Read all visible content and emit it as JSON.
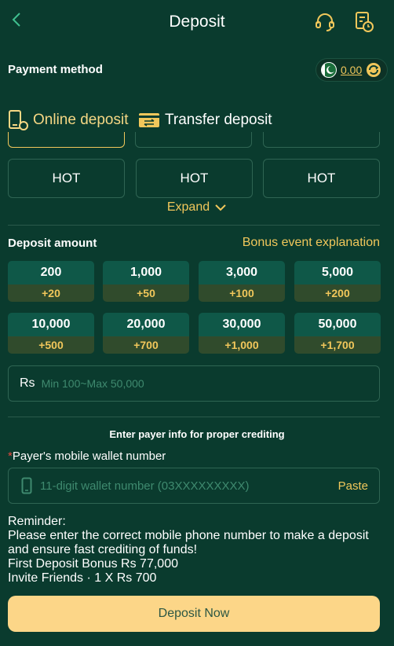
{
  "header": {
    "title": "Deposit"
  },
  "payment": {
    "label": "Payment method",
    "balance": "0.00"
  },
  "tabs": [
    {
      "label": "Online deposit",
      "active": true
    },
    {
      "label": "Transfer deposit",
      "active": false
    }
  ],
  "methods": [
    "HOT",
    "HOT",
    "HOT"
  ],
  "expand_label": "Expand",
  "deposit_amount": {
    "label": "Deposit amount",
    "bonus_link": "Bonus event explanation",
    "options": [
      {
        "amount": "200",
        "bonus": "+20"
      },
      {
        "amount": "1,000",
        "bonus": "+50"
      },
      {
        "amount": "3,000",
        "bonus": "+100"
      },
      {
        "amount": "5,000",
        "bonus": "+200"
      },
      {
        "amount": "10,000",
        "bonus": "+500"
      },
      {
        "amount": "20,000",
        "bonus": "+700"
      },
      {
        "amount": "30,000",
        "bonus": "+1,000"
      },
      {
        "amount": "50,000",
        "bonus": "+1,700"
      }
    ],
    "currency": "Rs",
    "placeholder": "Min 100~Max 50,000"
  },
  "payer": {
    "info_title": "Enter payer info for proper crediting",
    "required_mark": "*",
    "wallet_label": "Payer's mobile wallet number",
    "wallet_placeholder": "11-digit wallet number (03XXXXXXXXX)",
    "paste_label": "Paste"
  },
  "reminder": [
    "Reminder:",
    "Please enter the correct mobile phone number to make a deposit",
    "and ensure fast crediting of funds!",
    "First Deposit Bonus Rs 77,000",
    "Invite Friends · 1 X Rs 700"
  ],
  "deposit_button": "Deposit Now",
  "colors": {
    "background": "#0a3b2e",
    "accent": "#f1c75b",
    "button": "#fcd688"
  }
}
